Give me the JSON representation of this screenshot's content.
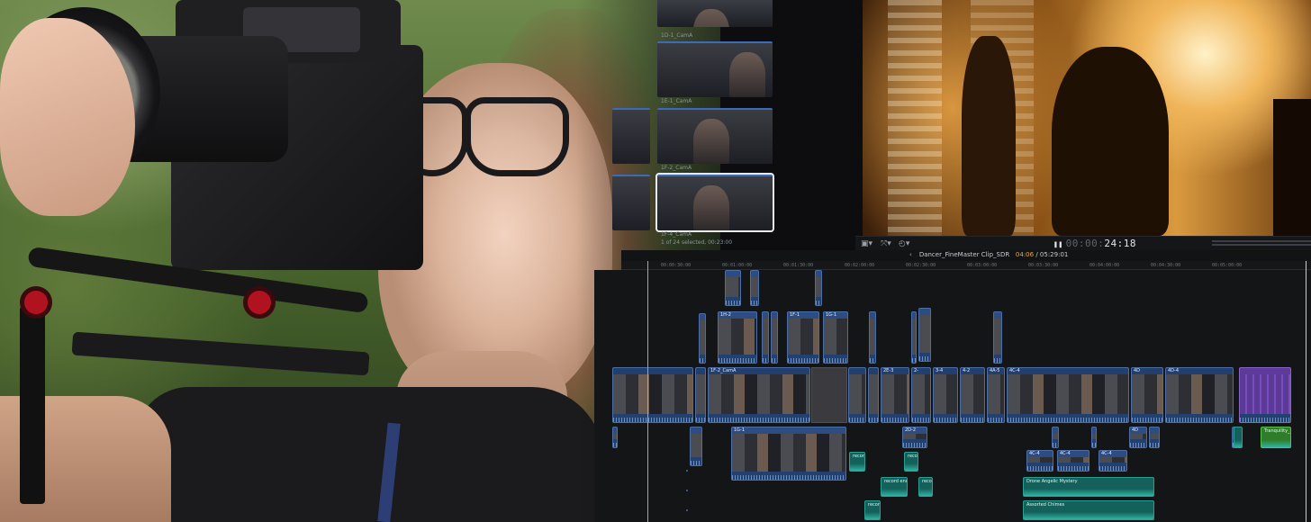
{
  "browser": {
    "clips": [
      {
        "label": ""
      },
      {
        "label": "1D-1_CamA"
      },
      {
        "label": "1E-1_CamA"
      },
      {
        "label": "1F-2_CamA"
      },
      {
        "label": "1F-4_CamA"
      }
    ],
    "status": "1 of 24 selected, 00:23:00"
  },
  "viewer": {
    "timecode_dim": "00:00:",
    "timecode_main": "24:18",
    "pause_glyph": "❚❚",
    "tools": {
      "view": "▣▾",
      "transform": "⤧▾",
      "speed": "◴▾"
    }
  },
  "timeline": {
    "back_glyph": "‹",
    "project_name": "Dancer_FineMaster Clip_SDR",
    "current_time": "04:06",
    "duration": "05:29:01",
    "ruler": [
      "00:00:30:00",
      "00:01:00:00",
      "00:01:30:00",
      "00:02:00:00",
      "00:02:30:00",
      "00:03:00:00",
      "00:03:30:00",
      "00:04:00:00",
      "00:04:30:00",
      "00:05:00:00"
    ],
    "connected_clips": [
      "1H-2",
      "1F-1",
      "1G-1"
    ],
    "primary_clips": [
      "1F-2_CamA",
      "2E-3",
      "2-",
      "3-4",
      "4-2",
      "4A-5",
      "4C-4",
      "4D",
      "4D-4"
    ],
    "lower_clips": [
      "1G-1",
      "2D-2",
      "4C-4",
      "4C-4",
      "4C-4",
      "4D"
    ],
    "audio_clips": [
      "recor...",
      "reco...",
      "record endi...",
      "reco...",
      "record...",
      "Drone Angelic Mystery",
      "Assorted Chimes"
    ],
    "green_clip": "Tranquility_Fl..."
  }
}
